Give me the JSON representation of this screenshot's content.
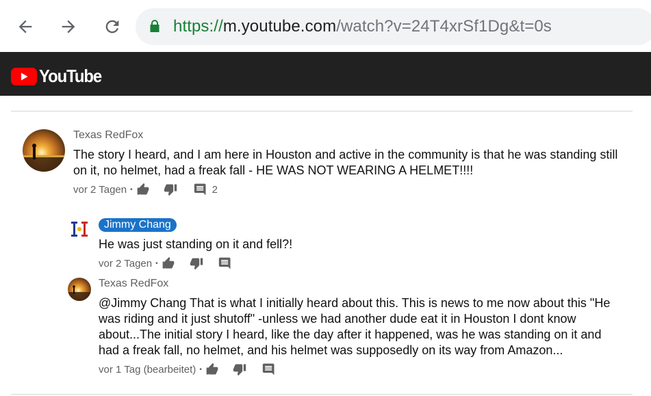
{
  "browser": {
    "url_scheme": "https://",
    "url_host": "m.youtube.com",
    "url_path": "/watch?v=24T4xrSf1Dg&t=0s",
    "icons": [
      "back-arrow-icon",
      "forward-arrow-icon",
      "reload-icon",
      "lock-icon"
    ]
  },
  "header": {
    "logo_text": "YouTube",
    "accent": "#ff0000",
    "background": "#212121"
  },
  "comments": [
    {
      "author": "Texas RedFox",
      "text": "The story I heard, and I am here in Houston and active in the community is that he was standing still on it, no helmet, had a freak fall - HE WAS NOT WEARING A HELMET!!!!",
      "time": "vor 2 Tagen",
      "reply_count": "2",
      "replies": [
        {
          "author": "Jimmy Chang",
          "author_highlighted": true,
          "text": "He was just standing on it and fell?!",
          "time": "vor 2 Tagen"
        },
        {
          "author": "Texas RedFox",
          "text": "@Jimmy Chang That is what I initially heard about this. This is news to me now about this \"He was riding and it just shutoff\" -unless we had another dude eat it in Houston I dont know about...The initial story I heard, like the day after it happened, was he was standing on it and had a freak fall, no helmet, and his helmet was supposedly on its way from Amazon...",
          "time": "vor 1 Tag (bearbeitet)"
        }
      ]
    }
  ],
  "meta_separator": "•"
}
